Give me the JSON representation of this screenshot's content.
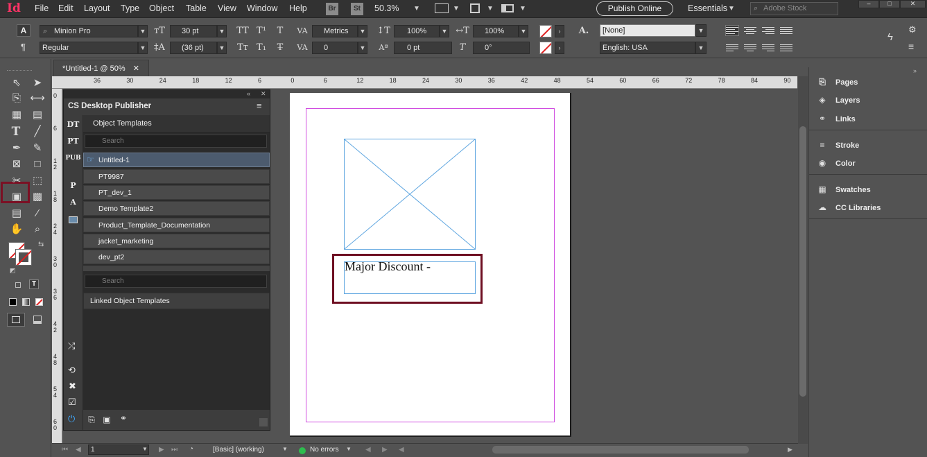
{
  "app": {
    "logo_text": "Id",
    "accent_color": "#ff3366"
  },
  "menu": {
    "items": [
      "File",
      "Edit",
      "Layout",
      "Type",
      "Object",
      "Table",
      "View",
      "Window",
      "Help"
    ],
    "bridge": "Br",
    "stock": "St",
    "zoom": "50.3%",
    "publish_online": "Publish Online",
    "workspace": "Essentials",
    "search_placeholder": "Adobe Stock"
  },
  "control": {
    "font_family": "Minion Pro",
    "font_style": "Regular",
    "font_size": "30 pt",
    "leading": "(36 pt)",
    "kerning": "Metrics",
    "tracking": "0",
    "vertical_scale": "100%",
    "baseline_shift": "0 pt",
    "horizontal_scale": "100%",
    "skew": "0°",
    "char_style": "[None]",
    "language": "English: USA"
  },
  "document": {
    "tab_title": "*Untitled-1 @ 50%",
    "frame_text": "Major Discount -"
  },
  "ruler": {
    "top_labels": [
      "36",
      "30",
      "24",
      "18",
      "12",
      "6",
      "0",
      "6",
      "12",
      "18",
      "24",
      "30",
      "36",
      "42",
      "48",
      "54",
      "60",
      "66",
      "72",
      "78",
      "84",
      "90"
    ],
    "left_labels": [
      "0",
      "6",
      "1 2",
      "1 8",
      "2 4",
      "3 0",
      "3 6",
      "4 2",
      "4 8",
      "5 4",
      "6 0"
    ]
  },
  "plugin": {
    "title": "CS Desktop Publisher",
    "side_buttons": [
      "DT",
      "PT",
      "PUB",
      "P",
      "A"
    ],
    "section_header": "Object Templates",
    "search_placeholder": "Search",
    "templates": [
      "Untitled-1",
      "PT9987",
      "PT_dev_1",
      "Demo Template2",
      "Product_Template_Documentation",
      "jacket_marketing",
      "dev_pt2"
    ],
    "linked_search_placeholder": "Search",
    "linked_header": "Linked Object Templates"
  },
  "status": {
    "page": "1",
    "style": "[Basic] (working)",
    "preflight": "No errors"
  },
  "right_panel": {
    "items": [
      "Pages",
      "Layers",
      "Links",
      "Stroke",
      "Color",
      "Swatches",
      "CC Libraries"
    ]
  }
}
